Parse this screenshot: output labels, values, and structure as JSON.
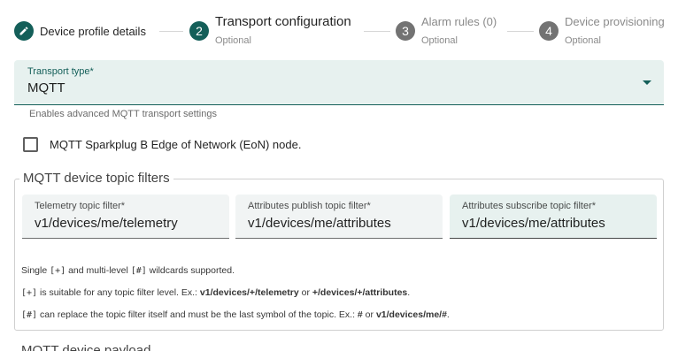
{
  "stepper": {
    "steps": [
      {
        "number": "",
        "title": "Device profile details",
        "subtitle": "",
        "state": "done",
        "icon": "pencil-icon"
      },
      {
        "number": "2",
        "title": "Transport configuration",
        "subtitle": "Optional",
        "state": "active"
      },
      {
        "number": "3",
        "title": "Alarm rules (0)",
        "subtitle": "Optional",
        "state": "pending"
      },
      {
        "number": "4",
        "title": "Device provisioning",
        "subtitle": "Optional",
        "state": "pending"
      }
    ]
  },
  "transport": {
    "label": "Transport type*",
    "value": "MQTT",
    "hint": "Enables advanced MQTT transport settings"
  },
  "sparkplug": {
    "label": "MQTT Sparkplug B Edge of Network (EoN) node.",
    "checked": false
  },
  "topic_filters": {
    "legend": "MQTT device topic filters",
    "telemetry": {
      "label": "Telemetry topic filter*",
      "value": "v1/devices/me/telemetry"
    },
    "attr_publish": {
      "label": "Attributes publish topic filter*",
      "value": "v1/devices/me/attributes"
    },
    "attr_subscribe": {
      "label": "Attributes subscribe topic filter*",
      "value": "v1/devices/me/attributes"
    },
    "notes": {
      "line1_a": "Single ",
      "line1_code1": "[+]",
      "line1_b": " and multi-level ",
      "line1_code2": "[#]",
      "line1_c": " wildcards supported.",
      "line2_code": "[+]",
      "line2_a": " is suitable for any topic filter level. Ex.: ",
      "line2_b1": "v1/devices/+/telemetry",
      "line2_or": " or ",
      "line2_b2": "+/devices/+/attributes",
      "line2_end": ".",
      "line3_code": "[#]",
      "line3_a": " can replace the topic filter itself and must be the last symbol of the topic. Ex.: ",
      "line3_b1": "#",
      "line3_or": " or ",
      "line3_b2": "v1/devices/me/#",
      "line3_end": "."
    }
  },
  "next_section": {
    "legend": "MQTT device payload"
  },
  "colors": {
    "primary": "#145f59",
    "primary_light_bg": "#e7f1ef",
    "pending": "#737373"
  }
}
